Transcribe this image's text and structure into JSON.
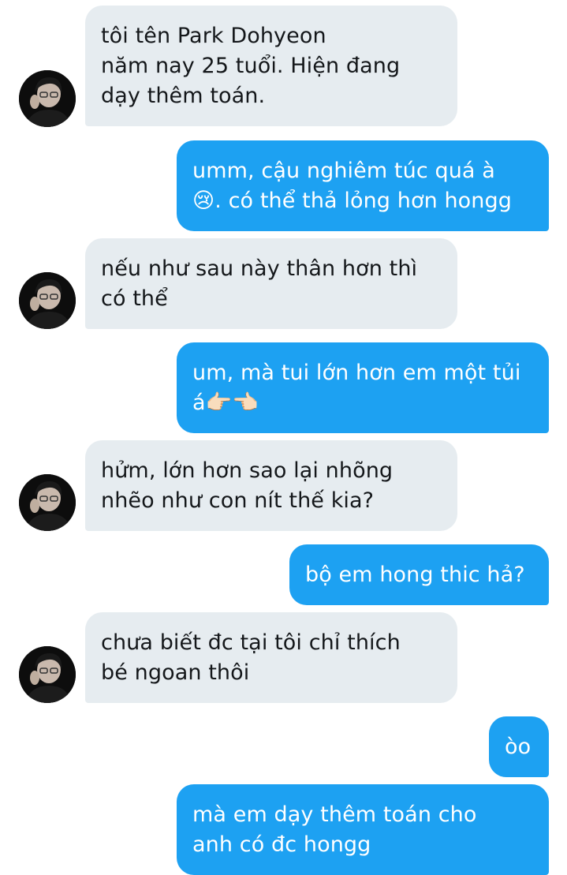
{
  "conversation": {
    "messages": [
      {
        "side": "in",
        "text": "tôi tên Park Dohyeon\nnăm nay 25 tuổi. Hiện đang\ndạy thêm toán."
      },
      {
        "side": "out",
        "text": "umm, cậu nghiêm túc quá à\n😢. có thể thả lỏng hơn hongg"
      },
      {
        "side": "in",
        "text": "nếu như sau này thân hơn thì\ncó thể"
      },
      {
        "side": "out",
        "text": "um, mà tui lớn hơn em một tủi\ná👉🏻👈🏻"
      },
      {
        "side": "in",
        "text": "hửm, lớn hơn sao lại nhõng\nnhẽo như con nít thế kia?"
      },
      {
        "side": "out",
        "text": "bộ em hong thic hả?"
      },
      {
        "side": "in",
        "text": "chưa biết đc tại tôi chỉ thích\nbé ngoan thôi"
      },
      {
        "side": "out",
        "text": "òo"
      },
      {
        "side": "out",
        "text": "mà em dạy thêm toán cho\nanh có đc hongg"
      }
    ],
    "colors": {
      "incoming_bubble": "#e6ecf0",
      "outgoing_bubble": "#1da1f2",
      "incoming_text": "#14171a",
      "outgoing_text": "#ffffff"
    },
    "avatar_icon": "profile-photo-avatar"
  }
}
